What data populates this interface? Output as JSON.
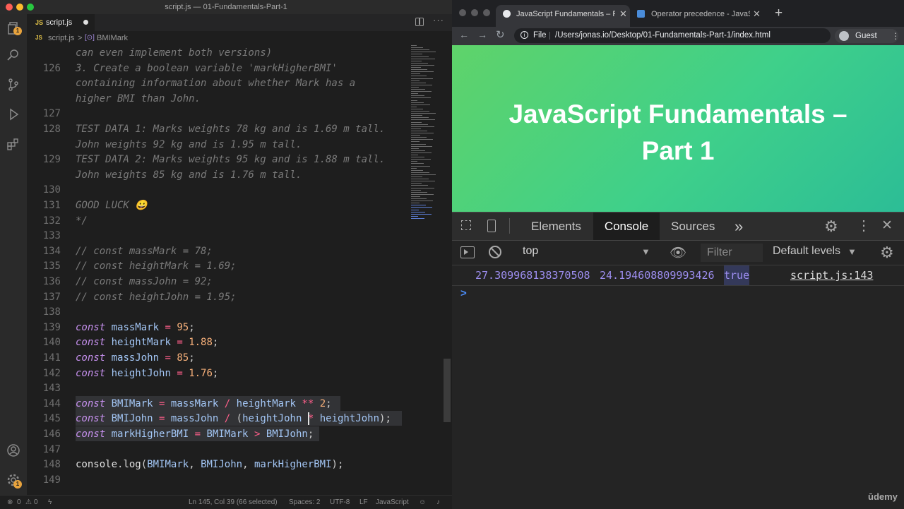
{
  "vscode": {
    "window_title": "script.js — 01-Fundamentals-Part-1",
    "tab": {
      "icon_text": "JS",
      "label": "script.js"
    },
    "breadcrumb": {
      "file": "script.js",
      "separator": ">",
      "symbol": "BMIMark"
    },
    "activity_badges": {
      "source_control": "1",
      "accounts": "1"
    },
    "status": {
      "errors": "0",
      "warnings": "0",
      "position": "Ln 145, Col 39 (66 selected)",
      "spaces": "Spaces: 2",
      "encoding": "UTF-8",
      "eol": "LF",
      "language": "JavaScript"
    },
    "lines": [
      {
        "n": "",
        "t": "can even implement both versions)"
      },
      {
        "n": "126",
        "t": "3. Create a boolean variable 'markHigherBMI'"
      },
      {
        "n": "",
        "t": "containing information about whether Mark has a"
      },
      {
        "n": "",
        "t": "higher BMI than John."
      },
      {
        "n": "127",
        "t": ""
      },
      {
        "n": "128",
        "t": "TEST DATA 1: Marks weights 78 kg and is 1.69 m tall."
      },
      {
        "n": "",
        "t": "John weights 92 kg and is 1.95 m tall."
      },
      {
        "n": "129",
        "t": "TEST DATA 2: Marks weights 95 kg and is 1.88 m tall."
      },
      {
        "n": "",
        "t": "John weights 85 kg and is 1.76 m tall."
      },
      {
        "n": "130",
        "t": ""
      },
      {
        "n": "131",
        "t": "GOOD LUCK 😀"
      },
      {
        "n": "132",
        "t": "*/"
      },
      {
        "n": "133",
        "t": ""
      },
      {
        "n": "134",
        "t": "// const massMark = 78;"
      },
      {
        "n": "135",
        "t": "// const heightMark = 1.69;"
      },
      {
        "n": "136",
        "t": "// const massJohn = 92;"
      },
      {
        "n": "137",
        "t": "// const heightJohn = 1.95;"
      },
      {
        "n": "138",
        "t": ""
      },
      {
        "n": "139",
        "t": "const massMark = 95;"
      },
      {
        "n": "140",
        "t": "const heightMark = 1.88;"
      },
      {
        "n": "141",
        "t": "const massJohn = 85;"
      },
      {
        "n": "142",
        "t": "const heightJohn = 1.76;"
      },
      {
        "n": "143",
        "t": ""
      },
      {
        "n": "144",
        "t": "const BMIMark = massMark / heightMark ** 2;"
      },
      {
        "n": "145",
        "t": "const BMIJohn = massJohn / (heightJohn * heightJohn);"
      },
      {
        "n": "146",
        "t": "const markHigherBMI = BMIMark > BMIJohn;"
      },
      {
        "n": "147",
        "t": ""
      },
      {
        "n": "148",
        "t": "console.log(BMIMark, BMIJohn, markHigherBMI);"
      },
      {
        "n": "149",
        "t": ""
      }
    ]
  },
  "chrome": {
    "tabs": [
      {
        "title": "JavaScript Fundamentals – Par"
      },
      {
        "title": "Operator precedence - JavaScri"
      }
    ],
    "new_tab": "+",
    "file_label": "File",
    "url": "/Users/jonas.io/Desktop/01-Fundamentals-Part-1/index.html",
    "profile": "Guest",
    "page_heading": "JavaScript Fundamentals – Part 1",
    "devtools": {
      "tabs": [
        "Elements",
        "Console",
        "Sources",
        "»"
      ],
      "context": "top",
      "filter_placeholder": "Filter",
      "levels": "Default levels",
      "output": {
        "v1": "27.309968138370508",
        "v2": "24.194608809993426",
        "v3": "true",
        "source": "script.js:143"
      },
      "prompt": ">"
    },
    "watermark": "ūdemy"
  }
}
